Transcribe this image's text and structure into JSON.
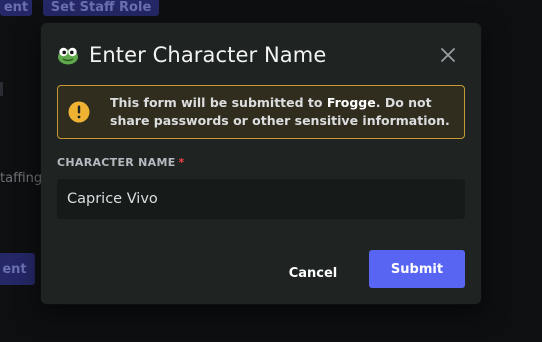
{
  "background": {
    "top_left_button": "ent",
    "top_mid_button": "Set Staff Role",
    "side_text": "taffing",
    "bottom_left_button": "ent"
  },
  "modal": {
    "app_icon": "frog-icon",
    "title": "Enter Character Name",
    "close_icon": "close-icon",
    "warning": {
      "icon": "warning-icon",
      "text_before": "This form will be submitted to ",
      "brand": "Frogge",
      "text_after": ". Do not share passwords or other sensitive information."
    },
    "field": {
      "label": "CHARACTER NAME",
      "required_marker": "*",
      "value": "Caprice Vivo"
    },
    "buttons": {
      "cancel": "Cancel",
      "submit": "Submit"
    }
  },
  "colors": {
    "accent": "#5865f2",
    "warning_border": "#c49a35",
    "required": "#f23f43"
  }
}
